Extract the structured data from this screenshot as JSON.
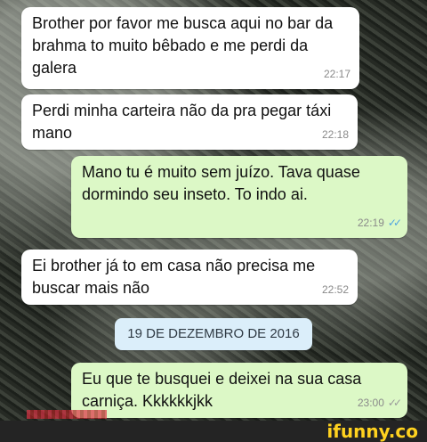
{
  "messages": [
    {
      "text": "Brother por favor me busca aqui no bar da brahma to muito bêbado e me perdi da galera",
      "time": "22:17"
    },
    {
      "text": "Perdi minha carteira não da pra pegar táxi mano",
      "time": "22:18"
    },
    {
      "text": "Mano tu é muito sem juízo. Tava quase dormindo seu inseto. To indo ai.",
      "time": "22:19",
      "ticks": "✓✓"
    },
    {
      "text": "Ei brother já to em casa não precisa me buscar mais não",
      "time": "22:52"
    },
    {
      "text": "Eu que te busquei e deixei na sua casa carniça. Kkkkkkjkk",
      "time": "23:00",
      "ticks": "✓✓"
    }
  ],
  "date_divider": "19 DE DEZEMBRO DE 2016",
  "watermark": "ifunny.co",
  "colors": {
    "incoming_bubble": "#ffffff",
    "outgoing_bubble": "#dcf8c6",
    "read_ticks": "#4fa3e0",
    "logo": "#ffd21f"
  }
}
